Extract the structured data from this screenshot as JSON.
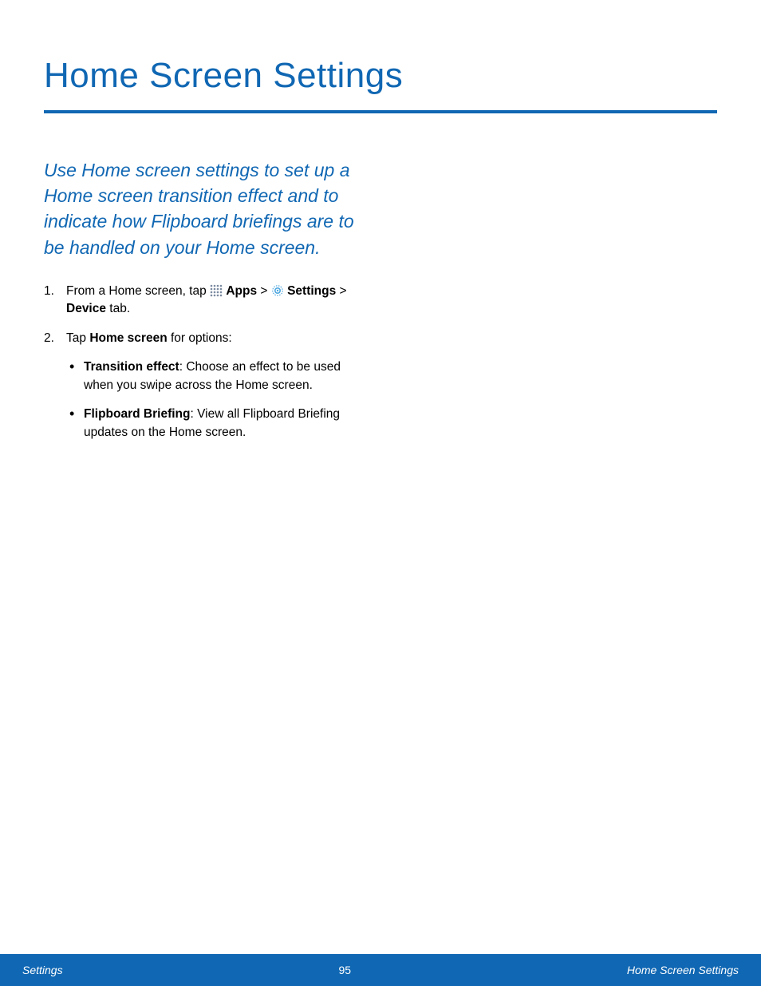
{
  "title": "Home Screen Settings",
  "intro": "Use Home screen settings to set up a Home screen transition effect and to indicate how Flipboard briefings are to be handled on your Home screen.",
  "steps": {
    "s1": {
      "pre": "From a Home screen, tap ",
      "apps": "Apps",
      "gt1": " > ",
      "settings": "Settings",
      "gt2": " > ",
      "device": "Device",
      "tab": " tab."
    },
    "s2": {
      "pre": "Tap ",
      "hs": "Home screen",
      "post": " for options:"
    }
  },
  "bullets": {
    "b1": {
      "label": "Transition effect",
      "text": ": Choose an effect to be used when you swipe across the Home screen."
    },
    "b2": {
      "label": "Flipboard Briefing",
      "text": ": View all Flipboard Briefing updates on the Home screen."
    }
  },
  "footer": {
    "left": "Settings",
    "center": "95",
    "right": "Home Screen Settings"
  }
}
